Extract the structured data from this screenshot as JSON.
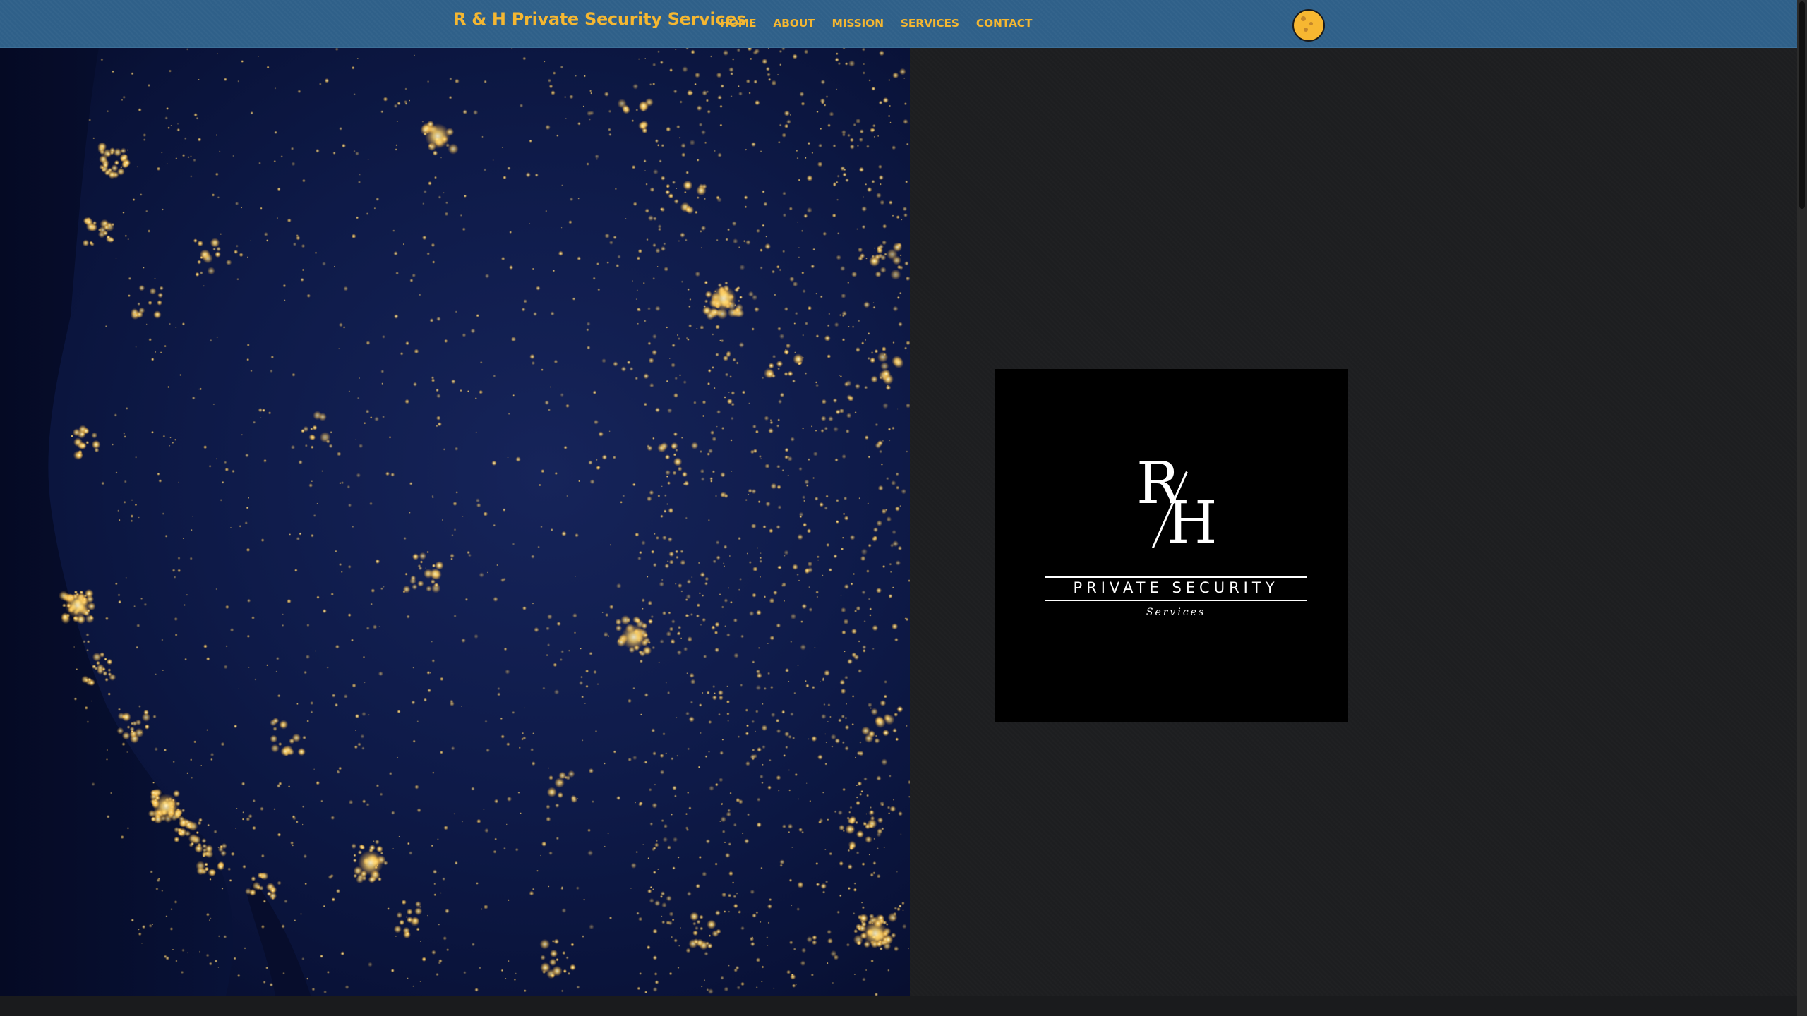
{
  "header": {
    "brand": "R & H Private Security Services",
    "nav": [
      {
        "label": "HOME"
      },
      {
        "label": "ABOUT"
      },
      {
        "label": "MISSION"
      },
      {
        "label": "SERVICES"
      },
      {
        "label": "CONTACT"
      }
    ],
    "theme_toggle_icon": "moon-icon"
  },
  "logo": {
    "monogram_top": "R",
    "monogram_bottom": "H",
    "title": "PRIVATE SECURITY",
    "subtitle": "Services"
  },
  "colors": {
    "navbar_bg": "#2f6089",
    "accent": "#f5b731",
    "page_bg": "#1d1e20",
    "logo_bg": "#000000"
  }
}
